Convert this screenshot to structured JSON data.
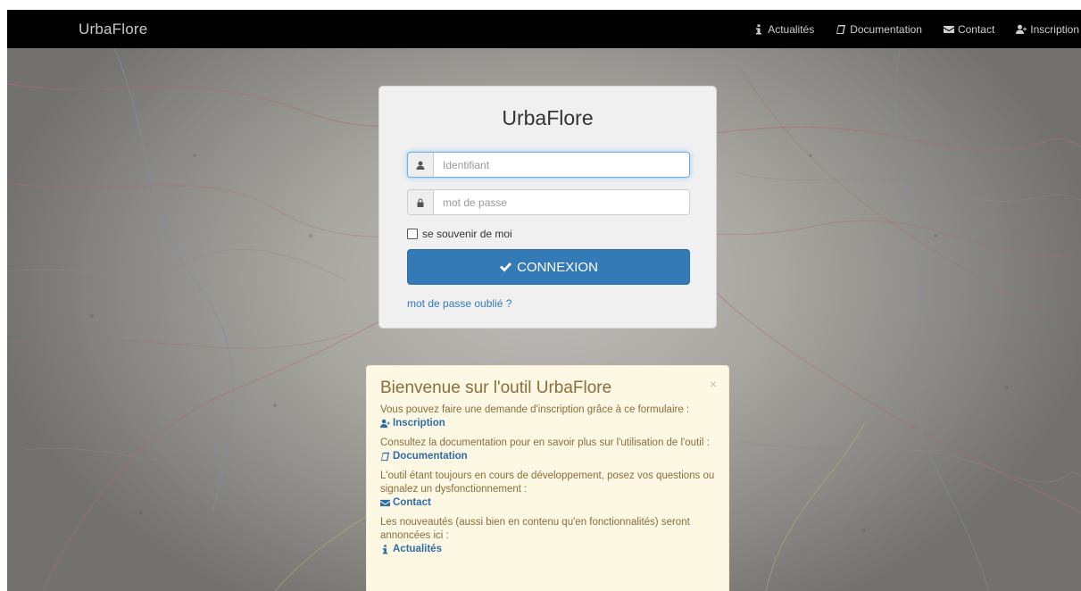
{
  "navbar": {
    "brand": "UrbaFlore",
    "links": [
      {
        "label": "Actualités",
        "icon": "info-icon"
      },
      {
        "label": "Documentation",
        "icon": "book-icon"
      },
      {
        "label": "Contact",
        "icon": "envelope-icon"
      },
      {
        "label": "Inscription",
        "icon": "user-plus-icon"
      }
    ]
  },
  "login": {
    "title": "UrbaFlore",
    "username_placeholder": "Identifiant",
    "password_placeholder": "mot de passe",
    "remember_label": "se souvenir de moi",
    "submit_label": "CONNEXION",
    "forgot_label": "mot de passe oublié ?"
  },
  "welcome": {
    "title": "Bienvenue sur l'outil UrbaFlore",
    "close": "×",
    "blocks": [
      {
        "text": "Vous pouvez faire une demande d'inscription grâce à ce formulaire :",
        "link": "Inscription"
      },
      {
        "text": "Consultez la documentation pour en savoir plus sur l'utilisation de l'outil :",
        "link": "Documentation"
      },
      {
        "text": "L'outil étant toujours en cours de développement, posez vos questions ou signalez un dysfonctionnement :",
        "link": "Contact"
      },
      {
        "text": "Les nouveautés (aussi bien en contenu qu'en fonctionnalités) seront annoncées ici :",
        "link": "Actualités"
      }
    ]
  },
  "colors": {
    "navbar_bg": "#000000",
    "primary": "#337ab7",
    "alert_bg": "#fcf8e3",
    "alert_text": "#8a6d3b"
  }
}
